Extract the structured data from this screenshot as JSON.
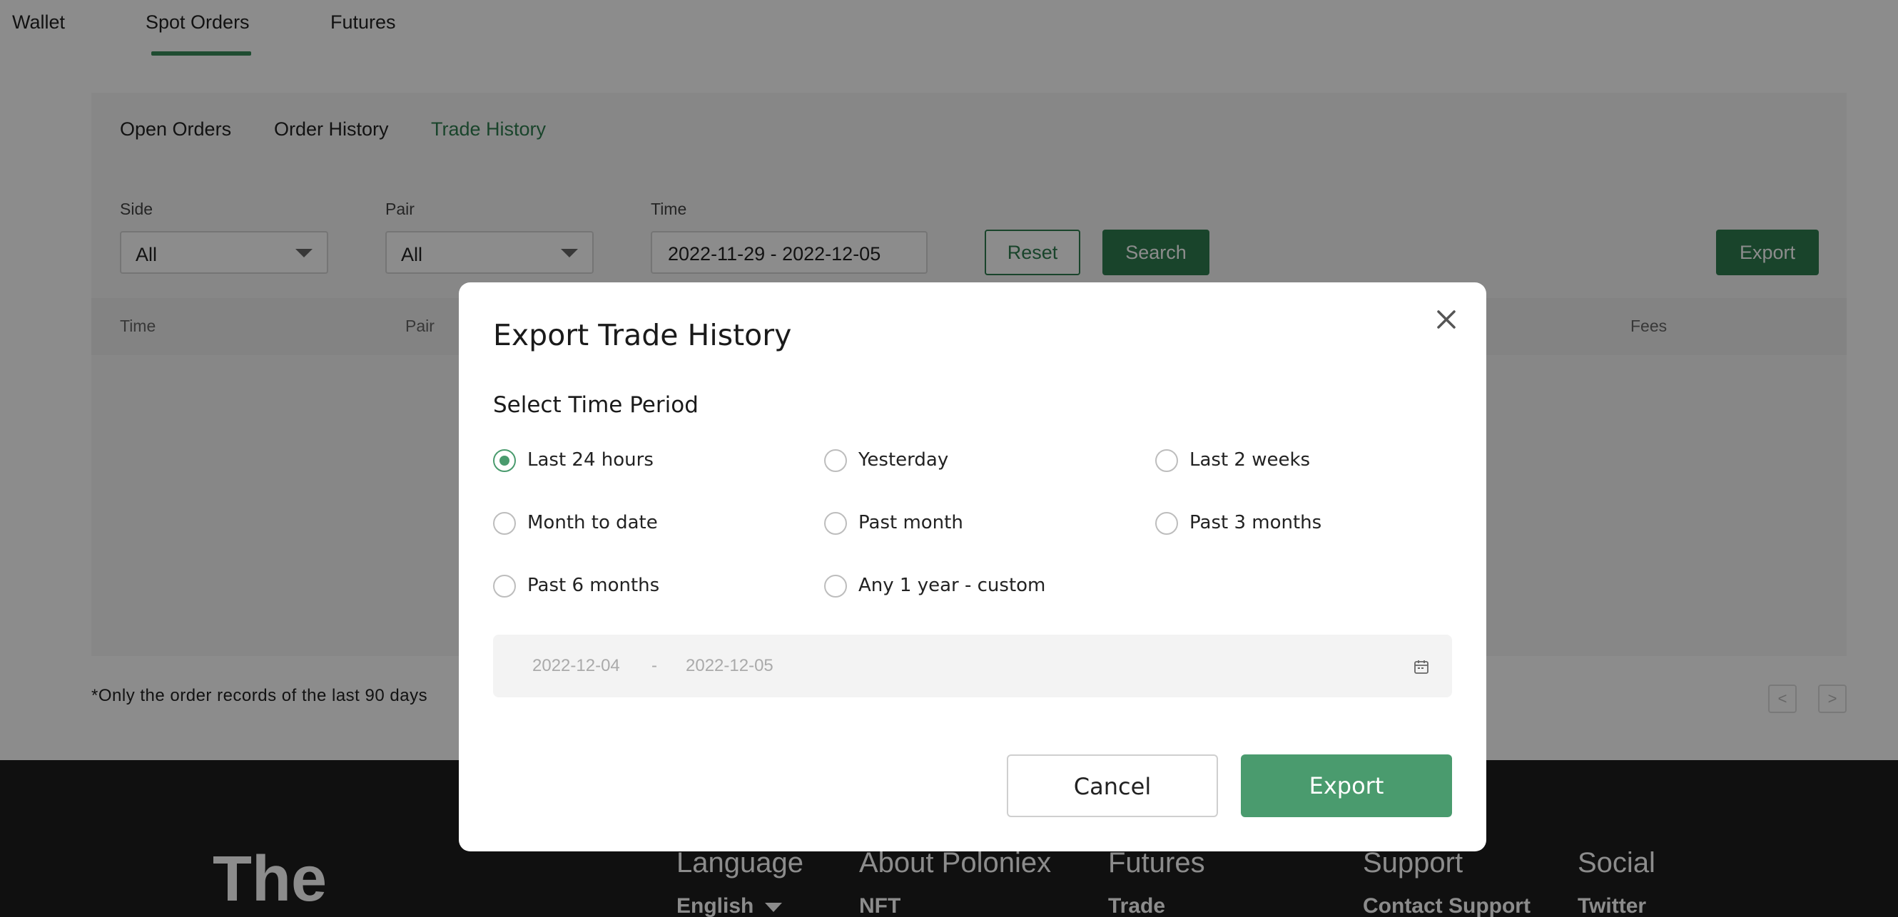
{
  "top_tabs": [
    "Wallet",
    "Spot Orders",
    "Futures"
  ],
  "sub_tabs": [
    "Open Orders",
    "Order History",
    "Trade History"
  ],
  "filters": {
    "side_label": "Side",
    "side_value": "All",
    "pair_label": "Pair",
    "pair_value": "All",
    "time_label": "Time",
    "time_value": "2022-11-29 - 2022-12-05"
  },
  "buttons": {
    "reset": "Reset",
    "search": "Search",
    "export": "Export"
  },
  "table_headers": {
    "time": "Time",
    "pair": "Pair",
    "fees": "Fees"
  },
  "note": "*Only the order records of the last 90 days",
  "pagination": {
    "prev": "<",
    "next": ">"
  },
  "footer": {
    "brand": "The",
    "language_heading": "Language",
    "language_value": "English",
    "about_heading": "About Poloniex",
    "about_link": "NFT",
    "futures_heading": "Futures",
    "futures_link": "Trade",
    "support_heading": "Support",
    "support_link": "Contact Support",
    "social_heading": "Social",
    "social_link": "Twitter"
  },
  "modal": {
    "title": "Export Trade History",
    "section_title": "Select Time Period",
    "options": [
      {
        "label": "Last 24 hours",
        "checked": true
      },
      {
        "label": "Yesterday",
        "checked": false
      },
      {
        "label": "Last 2 weeks",
        "checked": false
      },
      {
        "label": "Month to date",
        "checked": false
      },
      {
        "label": "Past month",
        "checked": false
      },
      {
        "label": "Past 3 months",
        "checked": false
      },
      {
        "label": "Past 6 months",
        "checked": false
      },
      {
        "label": "Any 1 year - custom",
        "checked": false
      }
    ],
    "range_start": "2022-12-04",
    "range_sep": "-",
    "range_end": "2022-12-05",
    "cancel": "Cancel",
    "export": "Export"
  },
  "colors": {
    "brand_green": "#2e7d4f",
    "modal_green": "#4a9b6e",
    "footer_bg": "#1e1e1e"
  }
}
